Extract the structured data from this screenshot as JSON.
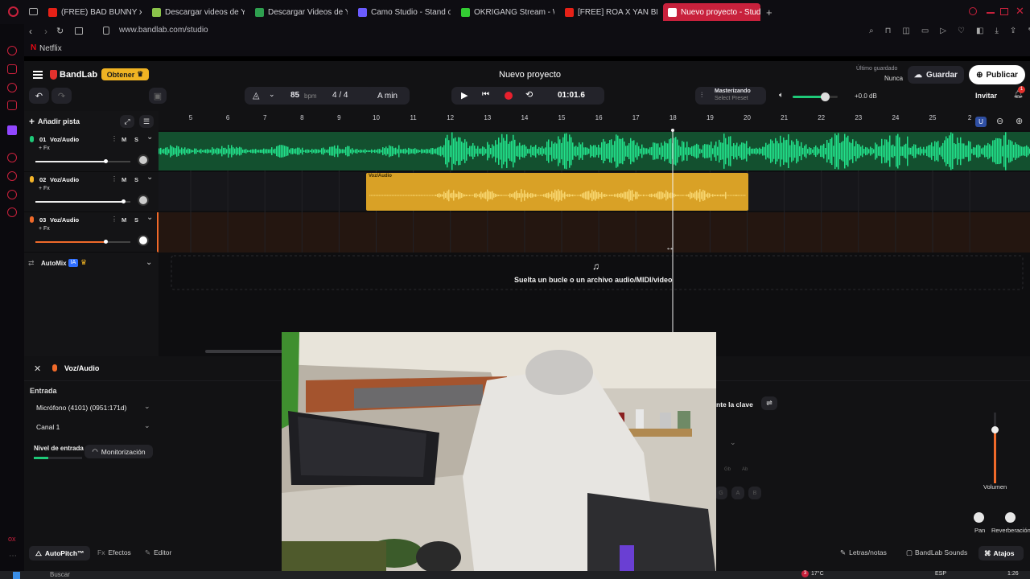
{
  "browser": {
    "tabs": [
      {
        "title": "(FREE) BAD BUNNY x TAIN",
        "color": "#e62117"
      },
      {
        "title": "Descargar videos de YouT",
        "color": "#8bc34a"
      },
      {
        "title": "Descargar Videos de YouT",
        "color": "#2e9f4f"
      },
      {
        "title": "Camo Studio - Stand out",
        "color": "#6b5cff"
      },
      {
        "title": "OKRIGANG Stream - Watc",
        "color": "#33cc33"
      },
      {
        "title": "[FREE] ROA X YAN BLOCK",
        "color": "#e62117"
      },
      {
        "title": "Nuevo proyecto - Studi",
        "color": "#ffffff"
      }
    ],
    "url": "www.bandlab.com/studio",
    "bookmark": "Netflix"
  },
  "header": {
    "brand": "BandLab",
    "get_label": "Obtener",
    "project_title": "Nuevo proyecto",
    "last_saved_label": "Último guardado",
    "last_saved_value": "Nunca",
    "save_label": "Guardar",
    "publish_label": "Publicar",
    "tempo_value": "85",
    "tempo_unit": "bpm",
    "time_signature": "4 / 4",
    "key": "A min",
    "time_display": "01:01.6",
    "mastering_label": "Masterizando",
    "mastering_preset": "Select Preset",
    "volume_db": "+0.0 dB",
    "invite_label": "Invitar",
    "notification_count": "1"
  },
  "tracks_panel": {
    "add_track_label": "Añadir pista",
    "tracks": [
      {
        "number": "01",
        "name": "Voz/Audio",
        "fx": "+ Fx",
        "mute": "M",
        "solo": "S",
        "color": "#1ec978",
        "volume": 0.74
      },
      {
        "number": "02",
        "name": "Voz/Audio",
        "fx": "+ Fx",
        "mute": "M",
        "solo": "S",
        "color": "#f5b529",
        "volume": 0.92
      },
      {
        "number": "03",
        "name": "Voz/Audio",
        "fx": "+ Fx",
        "mute": "M",
        "solo": "S",
        "color": "#f06a2a",
        "volume": 0.74
      }
    ],
    "automix_label": "AutoMix",
    "automix_badge": "IA"
  },
  "ruler": {
    "bars": [
      "5",
      "6",
      "7",
      "8",
      "9",
      "10",
      "11",
      "12",
      "13",
      "14",
      "15",
      "16",
      "17",
      "18",
      "19",
      "20",
      "21",
      "22",
      "23",
      "24",
      "25",
      "2"
    ]
  },
  "clip": {
    "label": "Voz/Audio"
  },
  "drop_zone": {
    "text": "Suelta un bucle o un archivo audio/MIDI/video"
  },
  "bottom_panel": {
    "track_name": "Voz/Audio",
    "input_label": "Entrada",
    "microphone": "Micrófono (4101) (0951:171d)",
    "channel": "Canal 1",
    "input_level_label": "Nivel de entrada",
    "monitoring_label": "Monitorización",
    "key_label": "nte la clave",
    "volume_label": "Volumen",
    "pan_label": "Pan",
    "reverb_label": "Reverberación",
    "tabs": [
      "AutoPitch™",
      "Efectos",
      "Editor"
    ],
    "right_tabs": [
      "Letras/notas",
      "BandLab Sounds",
      "Atajos"
    ],
    "key_buttons": [
      "G",
      "A",
      "B"
    ],
    "key_small": [
      "Gb",
      "Ab"
    ]
  },
  "taskbar": {
    "search_placeholder": "Buscar",
    "temperature": "17°C",
    "language": "ESP",
    "clock": "1:26",
    "weather_badge": "3"
  },
  "colors": {
    "accent": "#c8213c",
    "track1": "#1ec978",
    "track2": "#f5b529",
    "track3": "#f06a2a",
    "automix_badge": "#2f6fff"
  }
}
